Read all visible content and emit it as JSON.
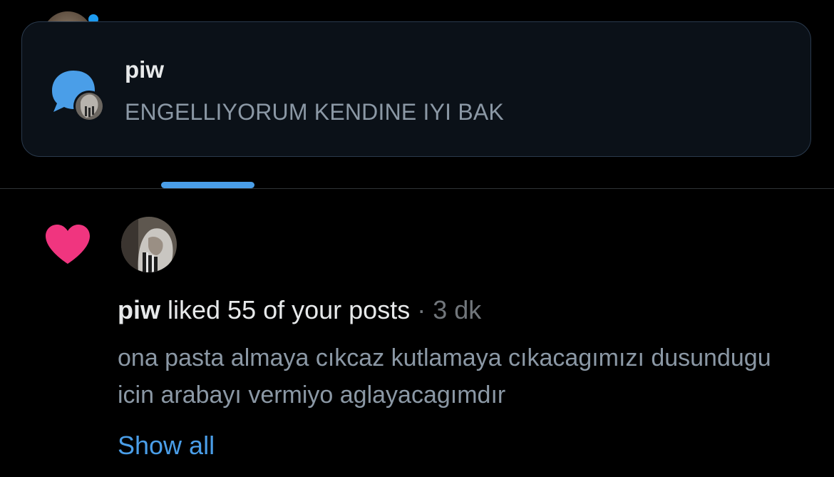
{
  "toast": {
    "title": "piw",
    "message": "ENGELLIYORUM KENDINE IYI BAK",
    "icon": "message-bubble-icon"
  },
  "notification": {
    "icon": "heart-icon",
    "username": "piw",
    "action": " liked 55 of your posts",
    "separator": " · ",
    "time": "3 dk",
    "post_text": "ona pasta almaya cıkcaz kutlamaya cıkacagımızı dusundugu icin arabayı vermiyo aglayacagımdır",
    "show_all_label": "Show all"
  },
  "colors": {
    "background": "#000000",
    "accent": "#4a9ee8",
    "heart": "#f0357f",
    "toast_bg": "#0b1118"
  }
}
